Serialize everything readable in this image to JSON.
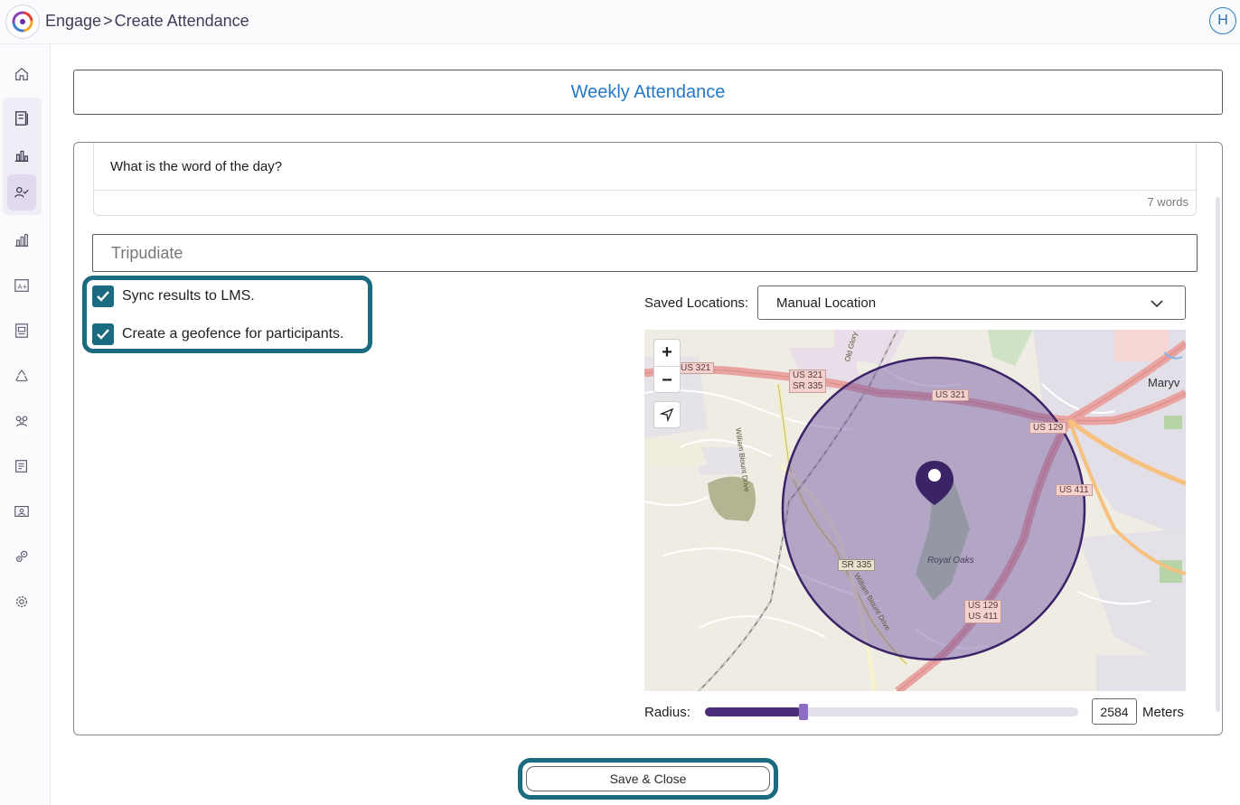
{
  "header": {
    "app_name": "Engage",
    "separator": ">",
    "page_name": "Create Attendance",
    "avatar_initial": "H"
  },
  "sidebar": {
    "items": [
      {
        "icon": "home-icon"
      },
      {
        "icon": "notebook-icon"
      },
      {
        "icon": "bar-chart-icon"
      },
      {
        "icon": "attendance-user-check-icon"
      },
      {
        "icon": "analytics-icon"
      },
      {
        "icon": "grade-a-plus-icon"
      },
      {
        "icon": "report-icon"
      },
      {
        "icon": "recycle-icon"
      },
      {
        "icon": "group-icon"
      },
      {
        "icon": "list-edit-icon"
      },
      {
        "icon": "id-card-icon"
      },
      {
        "icon": "integration-gears-icon"
      },
      {
        "icon": "settings-gear-icon"
      }
    ],
    "active_index": 3
  },
  "form": {
    "title": "Weekly Attendance",
    "question": "What is the word of the day?",
    "word_count": "7 words",
    "answer_value": "Tripudiate",
    "sync_lms_label": "Sync results to LMS.",
    "sync_lms_checked": true,
    "geofence_label": "Create a geofence for participants.",
    "geofence_checked": true,
    "saved_locations_label": "Saved Locations:",
    "saved_locations_value": "Manual Location",
    "radius_label": "Radius:",
    "radius_value": "2584",
    "radius_unit": "Meters",
    "radius_slider_fraction": 0.26,
    "save_label": "Save & Close"
  },
  "map": {
    "zoom_in": "+",
    "zoom_out": "−",
    "labels": {
      "us321_a": "US 321",
      "us321_sr335_a": "US 321",
      "us321_sr335_b": "SR 335",
      "us321_b": "US 321",
      "us129_a": "US 129",
      "us411_a": "US 411",
      "sr335": "SR 335",
      "us129_411_a": "US 129",
      "us129_411_b": "US 411",
      "royal_oaks": "Royal Oaks",
      "maryville": "Maryv",
      "william_blount_1": "William Blount Drive",
      "william_blount_2": "William Blount Drive",
      "old_glory": "Old Glory"
    },
    "colors": {
      "geofence_fill": "#6a4fa0",
      "geofence_stroke": "#3a2366",
      "pin": "#3b2466"
    }
  },
  "colors": {
    "accent_teal": "#1a6b80",
    "title_blue": "#2478c6",
    "slider_fill": "#4b2d7a"
  }
}
